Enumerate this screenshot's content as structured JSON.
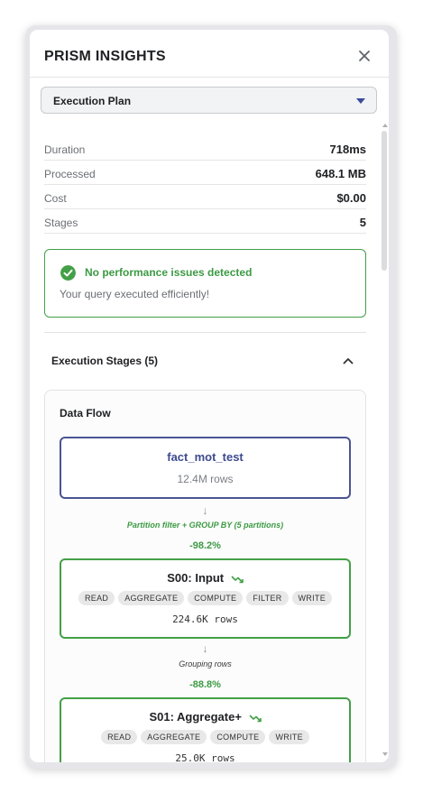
{
  "header": {
    "title": "PRISM INSIGHTS",
    "close_icon": "close-icon"
  },
  "view_select": {
    "selected": "Execution Plan"
  },
  "stats": [
    {
      "label": "Duration",
      "value": "718ms"
    },
    {
      "label": "Processed",
      "value": "648.1 MB"
    },
    {
      "label": "Cost",
      "value": "$0.00"
    },
    {
      "label": "Stages",
      "value": "5"
    }
  ],
  "status": {
    "icon": "check-circle-icon",
    "title": "No performance issues detected",
    "subtitle": "Your query executed efficiently!",
    "color": "#43a047"
  },
  "stages_section": {
    "title": "Execution Stages (5)",
    "expanded": true
  },
  "data_flow": {
    "title": "Data Flow",
    "source": {
      "name": "fact_mot_test",
      "rows": "12.4M rows"
    },
    "edges": [
      {
        "label": "Partition filter + GROUP BY (5 partitions)",
        "pct": "-98.2%"
      },
      {
        "label": "Grouping rows",
        "pct": "-88.8%"
      }
    ],
    "stages": [
      {
        "title": "S00: Input",
        "tags": [
          "READ",
          "AGGREGATE",
          "COMPUTE",
          "FILTER",
          "WRITE"
        ],
        "rows": "224.6K rows"
      },
      {
        "title": "S01: Aggregate+",
        "tags": [
          "READ",
          "AGGREGATE",
          "COMPUTE",
          "WRITE"
        ],
        "rows": "25.0K rows"
      }
    ]
  },
  "colors": {
    "accent": "#3d4a8f",
    "success": "#43a047"
  }
}
